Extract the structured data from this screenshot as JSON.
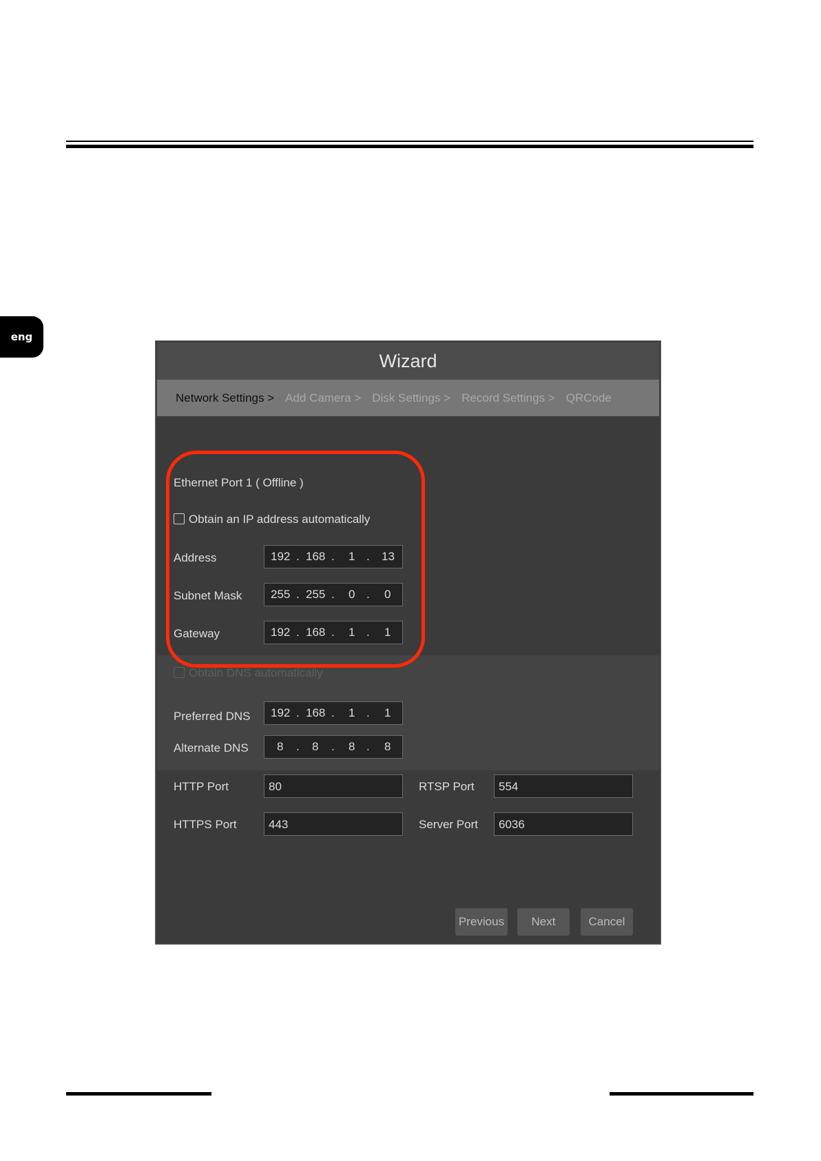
{
  "lang_tab": "eng",
  "wizard": {
    "title": "Wizard",
    "steps": [
      "Network Settings >",
      "Add Camera >",
      "Disk Settings >",
      "Record Settings >",
      "QRCode"
    ],
    "ethernet_label": "Ethernet Port 1 ( Offline )",
    "obtain_ip_label": "Obtain an IP address automatically",
    "obtain_ip_checked": false,
    "address": {
      "label": "Address",
      "octets": [
        "192",
        "168",
        "1",
        "13"
      ]
    },
    "subnet": {
      "label": "Subnet Mask",
      "octets": [
        "255",
        "255",
        "0",
        "0"
      ]
    },
    "gateway": {
      "label": "Gateway",
      "octets": [
        "192",
        "168",
        "1",
        "1"
      ]
    },
    "obtain_dns_label": "Obtain DNS automatically",
    "obtain_dns_checked": false,
    "preferred_dns": {
      "label": "Preferred DNS",
      "octets": [
        "192",
        "168",
        "1",
        "1"
      ]
    },
    "alternate_dns": {
      "label": "Alternate DNS",
      "octets": [
        "8",
        "8",
        "8",
        "8"
      ]
    },
    "http_port": {
      "label": "HTTP Port",
      "value": "80"
    },
    "https_port": {
      "label": "HTTPS Port",
      "value": "443"
    },
    "rtsp_port": {
      "label": "RTSP Port",
      "value": "554"
    },
    "server_port": {
      "label": "Server Port",
      "value": "6036"
    },
    "buttons": {
      "previous": "Previous",
      "next": "Next",
      "cancel": "Cancel"
    }
  },
  "colors": {
    "highlight": "#ff2a0a",
    "panel": "#3b3b3b",
    "steps_bar": "#777777"
  }
}
